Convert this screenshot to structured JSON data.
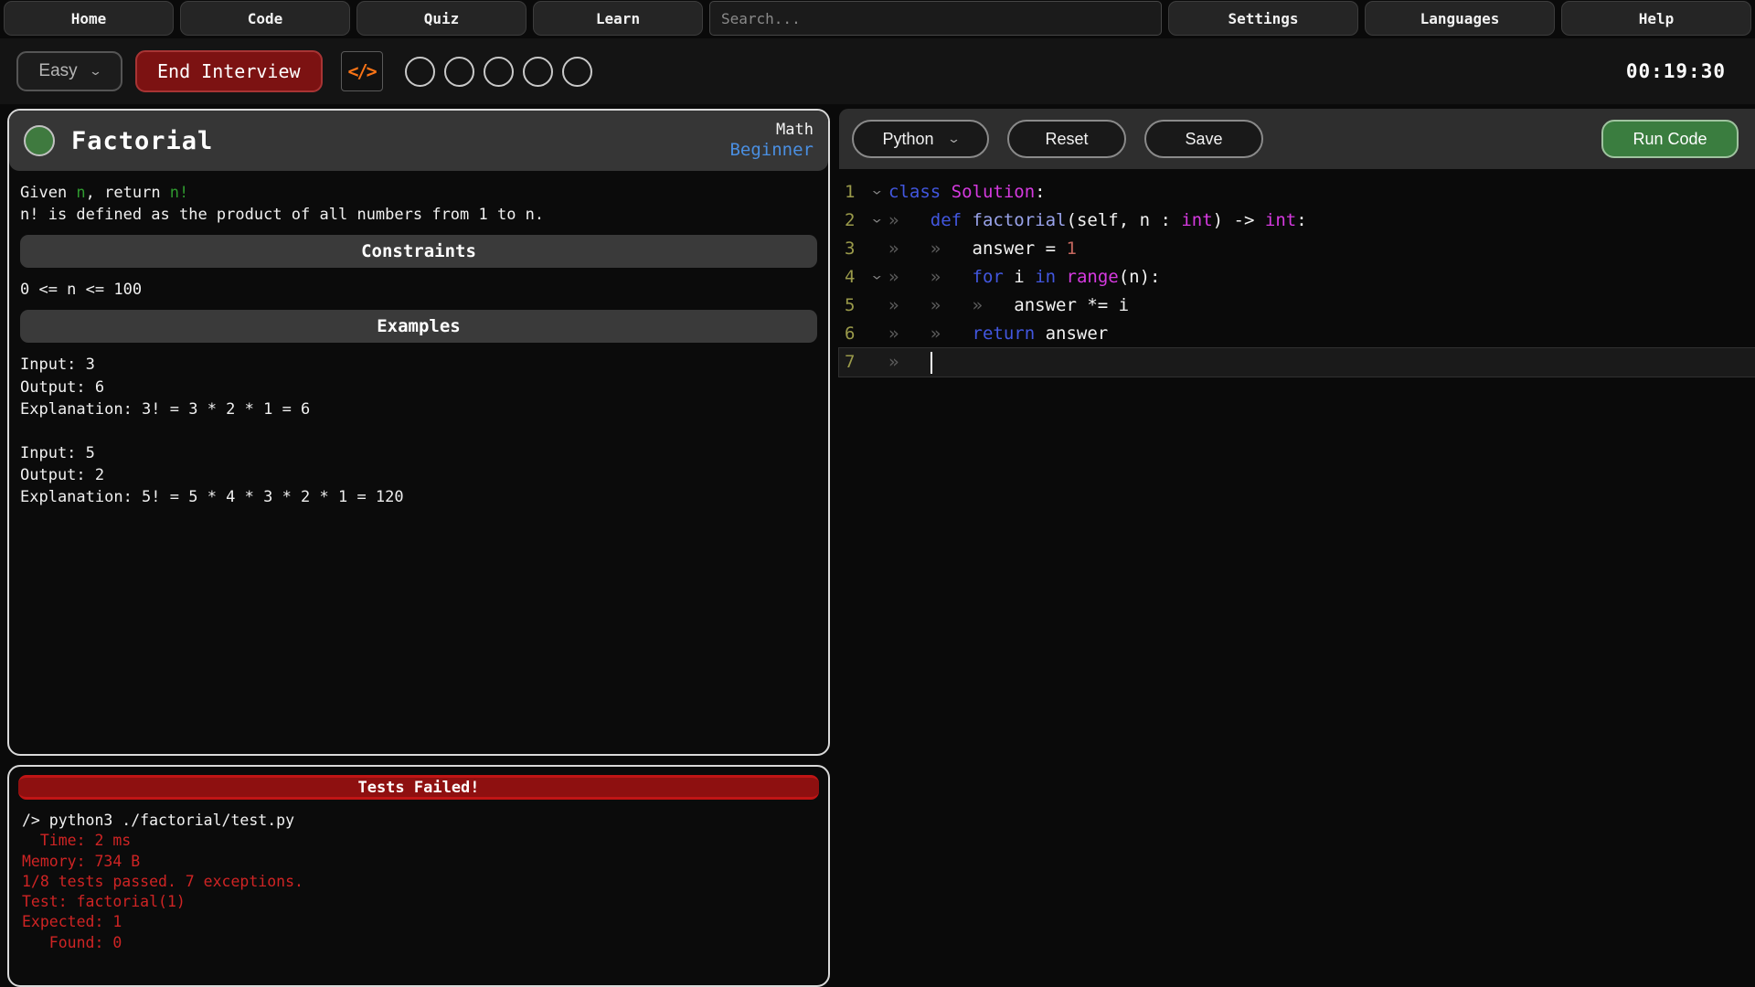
{
  "nav": {
    "left_tabs": [
      {
        "label": "Home"
      },
      {
        "label": "Code"
      },
      {
        "label": "Quiz"
      },
      {
        "label": "Learn"
      }
    ],
    "search_placeholder": "Search...",
    "right_tabs": [
      {
        "label": "Settings"
      },
      {
        "label": "Languages"
      },
      {
        "label": "Help"
      }
    ]
  },
  "toolbar": {
    "difficulty": "Easy",
    "end_interview_label": "End Interview",
    "code_icon": "</>",
    "progress_circles": 5,
    "timer": "00:19:30"
  },
  "problem": {
    "title": "Factorial",
    "category": "Math",
    "difficulty": "Beginner",
    "intro": [
      {
        "segments": [
          {
            "t": "Given ",
            "c": "w"
          },
          {
            "t": "n",
            "c": "g"
          },
          {
            "t": ", return ",
            "c": "w"
          },
          {
            "t": "n!",
            "c": "g"
          }
        ]
      },
      {
        "segments": [
          {
            "t": "n! is defined as the product of all numbers from 1 to n.",
            "c": "w"
          }
        ]
      }
    ],
    "sections": [
      {
        "heading": "Constraints",
        "lines": [
          "0 <= n <= 100"
        ]
      },
      {
        "heading": "Examples",
        "lines": [
          "Input: 3",
          "Output: 6",
          "Explanation: 3! = 3 * 2 * 1 = 6",
          "",
          "Input: 5",
          "Output: 2",
          "Explanation: 5! = 5 * 4 * 3 * 2 * 1 = 120"
        ]
      }
    ]
  },
  "editor": {
    "language": "Python",
    "reset_label": "Reset",
    "save_label": "Save",
    "run_label": "Run Code",
    "lines": [
      {
        "n": "1",
        "fold": true,
        "active": false,
        "segs": [
          {
            "t": "class",
            "c": "kw"
          },
          {
            "t": " ",
            "c": "pl"
          },
          {
            "t": "Solution",
            "c": "ty"
          },
          {
            "t": ":",
            "c": "pl"
          }
        ]
      },
      {
        "n": "2",
        "fold": true,
        "active": false,
        "segs": [
          {
            "t": "»   ",
            "c": "mk"
          },
          {
            "t": "def",
            "c": "kw"
          },
          {
            "t": " ",
            "c": "pl"
          },
          {
            "t": "factorial",
            "c": "fn"
          },
          {
            "t": "(self, n : ",
            "c": "pl"
          },
          {
            "t": "int",
            "c": "ty"
          },
          {
            "t": ") -> ",
            "c": "pl"
          },
          {
            "t": "int",
            "c": "ty"
          },
          {
            "t": ":",
            "c": "pl"
          }
        ]
      },
      {
        "n": "3",
        "fold": false,
        "active": false,
        "segs": [
          {
            "t": "»   ",
            "c": "mk"
          },
          {
            "t": "»   ",
            "c": "mk"
          },
          {
            "t": "answer = ",
            "c": "pl"
          },
          {
            "t": "1",
            "c": "num"
          }
        ]
      },
      {
        "n": "4",
        "fold": true,
        "active": false,
        "segs": [
          {
            "t": "»   ",
            "c": "mk"
          },
          {
            "t": "»   ",
            "c": "mk"
          },
          {
            "t": "for",
            "c": "kw"
          },
          {
            "t": " i ",
            "c": "pl"
          },
          {
            "t": "in",
            "c": "kw"
          },
          {
            "t": " ",
            "c": "pl"
          },
          {
            "t": "range",
            "c": "ty"
          },
          {
            "t": "(n):",
            "c": "pl"
          }
        ]
      },
      {
        "n": "5",
        "fold": false,
        "active": false,
        "segs": [
          {
            "t": "»   ",
            "c": "mk"
          },
          {
            "t": "»   ",
            "c": "mk"
          },
          {
            "t": "»   ",
            "c": "mk"
          },
          {
            "t": "answer *= i",
            "c": "pl"
          }
        ]
      },
      {
        "n": "6",
        "fold": false,
        "active": false,
        "segs": [
          {
            "t": "»   ",
            "c": "mk"
          },
          {
            "t": "»   ",
            "c": "mk"
          },
          {
            "t": "return",
            "c": "kw"
          },
          {
            "t": " answer",
            "c": "pl"
          }
        ]
      },
      {
        "n": "7",
        "fold": false,
        "active": true,
        "segs": [
          {
            "t": "»   ",
            "c": "mk"
          },
          {
            "t": "",
            "c": "cur"
          }
        ]
      }
    ]
  },
  "tests": {
    "banner": "Tests Failed!",
    "output": [
      {
        "text": "/> python3 ./factorial/test.py",
        "red": false
      },
      {
        "text": "  Time: 2 ms",
        "red": true
      },
      {
        "text": "Memory: 734 B",
        "red": true
      },
      {
        "text": "1/8 tests passed. 7 exceptions.",
        "red": true
      },
      {
        "text": "Test: factorial(1)",
        "red": true
      },
      {
        "text": "Expected: 1",
        "red": true
      },
      {
        "text": "   Found: 0",
        "red": true
      }
    ]
  },
  "colors": {
    "keyword_blue": "#4257e0",
    "type_magenta": "#d63ae0",
    "function_lavender": "#99a3ea",
    "number_salmon": "#c5675e",
    "line_number_olive": "#9a9a4a",
    "green_token": "#2f9a2f",
    "beginner_blue": "#4a8fe2",
    "icon_orange": "#f97316",
    "run_green": "#3a7d3f",
    "end_red": "#7c1212",
    "banner_red": "#8e1010",
    "test_text_red": "#cf2424"
  }
}
